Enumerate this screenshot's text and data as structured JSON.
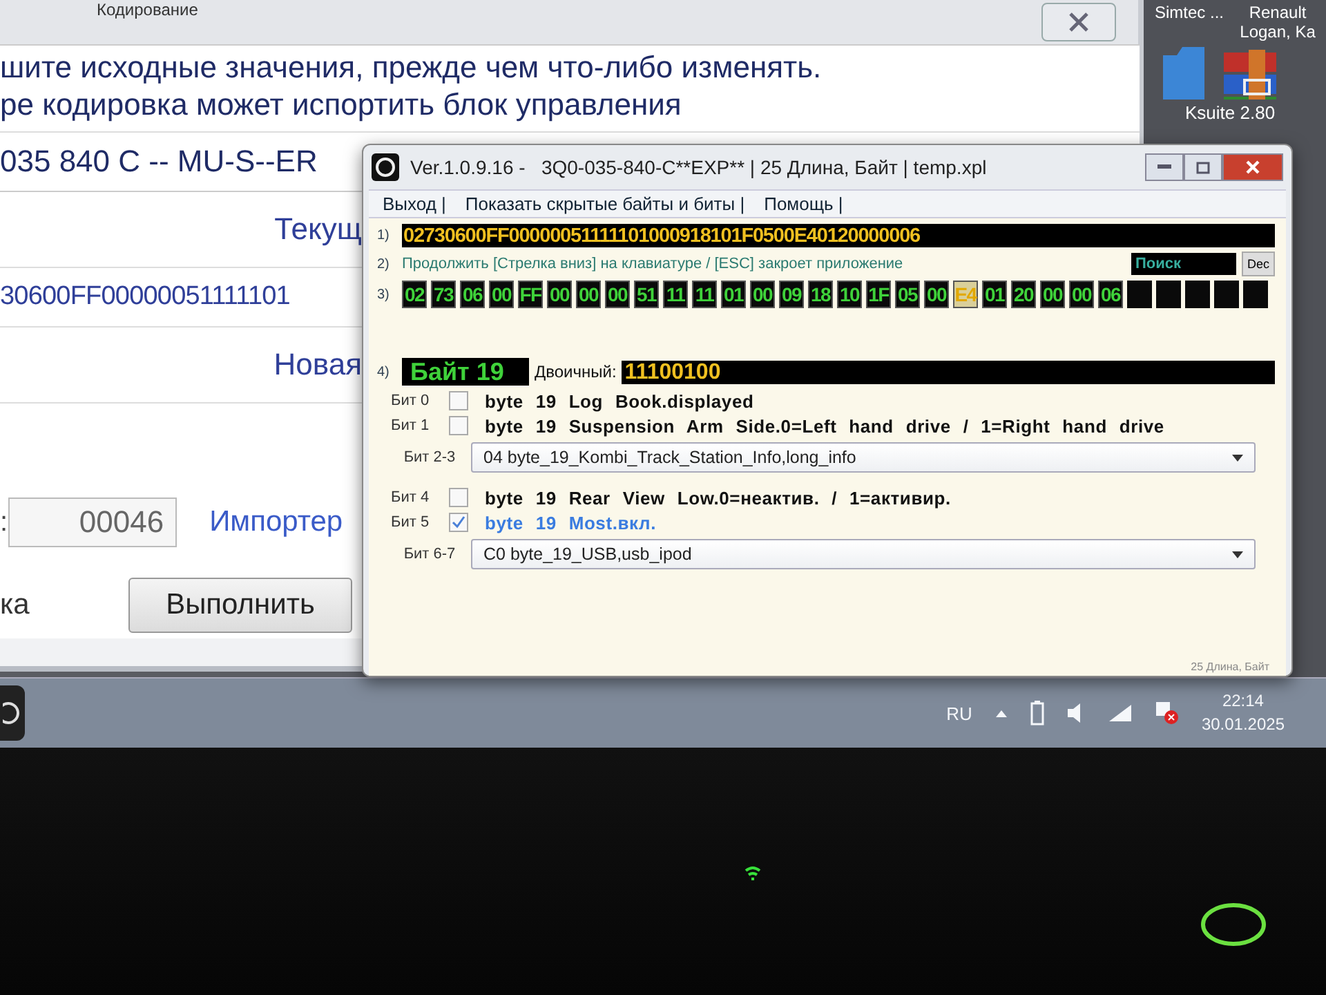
{
  "background_window": {
    "title": "Кодирование",
    "lines": [
      "шите исходные значения, прежде чем что-либо изменять.",
      "ре кодировка может испортить блок управления"
    ],
    "part_number": "035 840 C -- MU-S--ER",
    "current_label": "Текущ",
    "current_value": "30600FF00000051111101",
    "new_label": "Новая",
    "field_label": ":",
    "field_value": "00046",
    "link": "Импортер",
    "action_label": "ка",
    "button": "Выполнить"
  },
  "desktop": {
    "top_labels": [
      "Simtec ...",
      "Renault Logan, Ka"
    ],
    "app_label": "Ksuite 2.80"
  },
  "dialog": {
    "title": "Ver.1.0.9.16 -   3Q0-035-840-C**EXP** | 25 Длина, Байт | temp.xpl",
    "menu": [
      "Выход |",
      "Показать скрытые байты и биты |",
      "Помощь |"
    ],
    "row1": {
      "number": "1)",
      "coding": "02730600FF0000005111110100091810​1F0500E40120000006"
    },
    "row2": {
      "number": "2)",
      "hint": "Продолжить [Стрелка вниз] на клавиатуре / [ESC] закроет приложение",
      "search_value": "Поиск",
      "dec_button": "Dec"
    },
    "row3": {
      "number": "3)",
      "bytes": [
        {
          "value": "02",
          "selected": false
        },
        {
          "value": "73",
          "selected": false
        },
        {
          "value": "06",
          "selected": false
        },
        {
          "value": "00",
          "selected": false
        },
        {
          "value": "FF",
          "selected": false
        },
        {
          "value": "00",
          "selected": false
        },
        {
          "value": "00",
          "selected": false
        },
        {
          "value": "00",
          "selected": false
        },
        {
          "value": "51",
          "selected": false
        },
        {
          "value": "11",
          "selected": false
        },
        {
          "value": "11",
          "selected": false
        },
        {
          "value": "01",
          "selected": false
        },
        {
          "value": "00",
          "selected": false
        },
        {
          "value": "09",
          "selected": false
        },
        {
          "value": "18",
          "selected": false
        },
        {
          "value": "10",
          "selected": false
        },
        {
          "value": "1F",
          "selected": false
        },
        {
          "value": "05",
          "selected": false
        },
        {
          "value": "00",
          "selected": false
        },
        {
          "value": "E4",
          "selected": true
        },
        {
          "value": "01",
          "selected": false
        },
        {
          "value": "20",
          "selected": false
        },
        {
          "value": "00",
          "selected": false
        },
        {
          "value": "00",
          "selected": false
        },
        {
          "value": "06",
          "selected": false
        }
      ]
    },
    "row4": {
      "number": "4)",
      "byte_label": "Байт 19",
      "binary_label": "Двоичный:",
      "binary_value": "11100100"
    },
    "bits": [
      {
        "kind": "checkbox",
        "label": "Бит 0",
        "checked": false,
        "text": "byte 19 Log Book.displayed"
      },
      {
        "kind": "checkbox",
        "label": "Бит 1",
        "checked": false,
        "text": "byte 19 Suspension Arm Side.0=Left hand drive / 1=Right hand drive"
      },
      {
        "kind": "dropdown",
        "label": "Бит 2-3",
        "value": "04 byte_19_Kombi_Track_Station_Info,long_info"
      },
      {
        "kind": "checkbox",
        "label": "Бит 4",
        "checked": false,
        "text": "byte 19 Rear View Low.0=неактив. / 1=активир."
      },
      {
        "kind": "checkbox",
        "label": "Бит 5",
        "checked": true,
        "text": "byte 19 Most.вкл."
      },
      {
        "kind": "dropdown",
        "label": "Бит 6-7",
        "value": "C0 byte_19_USB,usb_ipod"
      }
    ],
    "status": "25 Длина, Байт"
  },
  "taskbar": {
    "language": "RU",
    "time": "22:14",
    "date": "30.01.2025"
  }
}
